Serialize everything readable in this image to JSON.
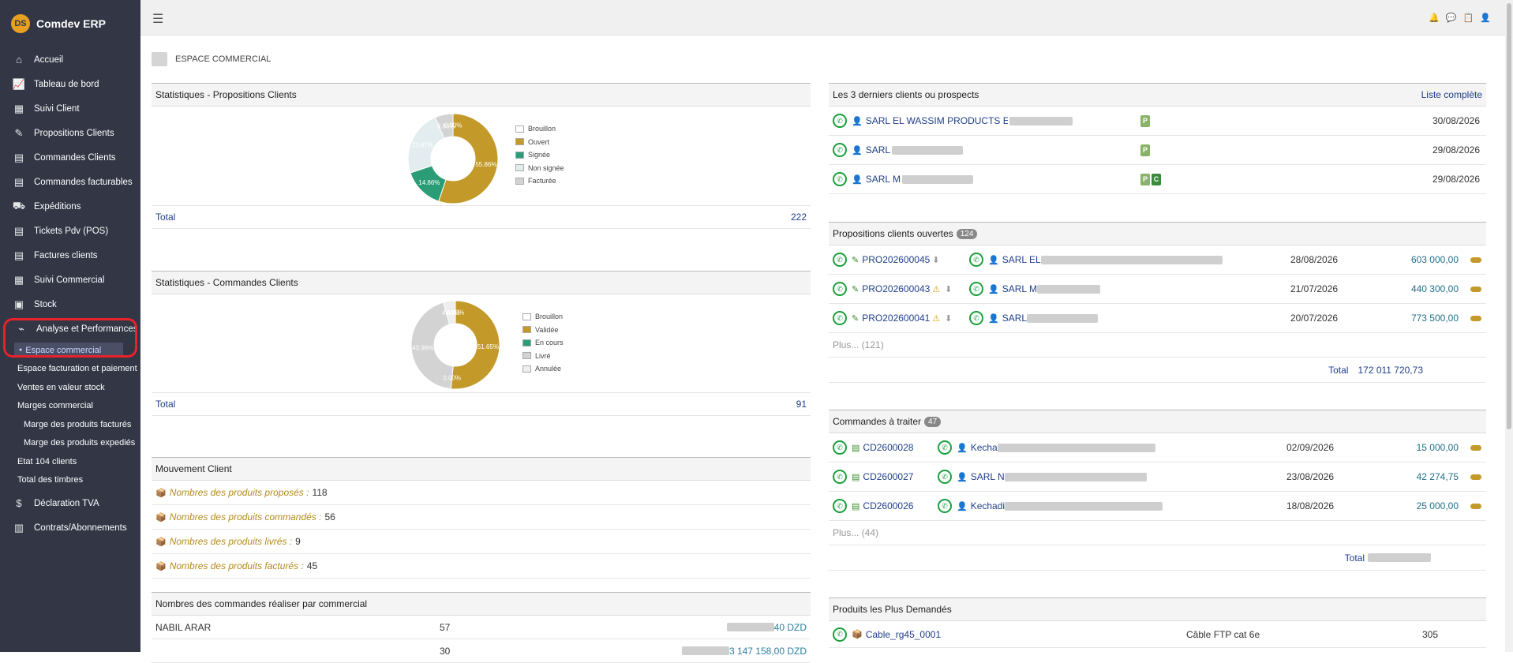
{
  "app": {
    "name": "Comdev ERP"
  },
  "sidebar": {
    "items": [
      {
        "label": "Accueil",
        "icon": "home-icon"
      },
      {
        "label": "Tableau de bord",
        "icon": "chart-line-icon"
      },
      {
        "label": "Suivi Client",
        "icon": "building-icon"
      },
      {
        "label": "Propositions Clients",
        "icon": "file-edit-icon"
      },
      {
        "label": "Commandes Clients",
        "icon": "file-icon"
      },
      {
        "label": "Commandes facturables",
        "icon": "file-icon"
      },
      {
        "label": "Expéditions",
        "icon": "dolly-icon"
      },
      {
        "label": "Tickets Pdv (POS)",
        "icon": "file-icon"
      },
      {
        "label": "Factures clients",
        "icon": "file-icon"
      },
      {
        "label": "Suivi Commercial",
        "icon": "building-icon"
      },
      {
        "label": "Stock",
        "icon": "box-icon"
      },
      {
        "label": "Analyse et Performances",
        "icon": "chart-area-icon"
      }
    ],
    "active_sub": "Espace commercial",
    "sub_items": [
      "Espace facturation et paiement",
      "Ventes en valeur stock",
      "Marges commercial"
    ],
    "sub2_items": [
      "Marge des produits facturés",
      "Marge des produits expediés"
    ],
    "sub3_items": [
      "Etat 104 clients",
      "Total des timbres"
    ],
    "bottom_items": [
      {
        "label": "Déclaration TVA",
        "icon": "tax-icon"
      },
      {
        "label": "Contrats/Abonnements",
        "icon": "briefcase-icon"
      }
    ]
  },
  "page": {
    "title": "ESPACE COMMERCIAL"
  },
  "stats_props": {
    "title": "Statistiques - Propositions Clients",
    "total_label": "Total",
    "total_value": "222",
    "legend": [
      "Brouillon",
      "Ouvert",
      "Signée",
      "Non signée",
      "Facturée"
    ],
    "slice_labels": [
      "55.86%",
      "14.86%",
      "23.87%",
      "6.60%",
      "0.00%"
    ]
  },
  "stats_cmds": {
    "title": "Statistiques - Commandes Clients",
    "total_label": "Total",
    "total_value": "91",
    "legend": [
      "Brouillon",
      "Validée",
      "En cours",
      "Livré",
      "Annulée"
    ],
    "slice_labels": [
      "51.65%",
      "0.00%",
      "43.96%",
      "4.40%",
      "0.00%"
    ]
  },
  "chart_data": [
    {
      "type": "pie",
      "title": "Statistiques - Propositions Clients",
      "categories": [
        "Brouillon",
        "Ouvert",
        "Signée",
        "Non signée",
        "Facturée"
      ],
      "values": [
        0,
        55.86,
        14.86,
        23.87,
        6.6
      ],
      "colors": [
        "#ffffff",
        "#c39a2a",
        "#2a9d77",
        "#e3edef",
        "#d3d3d3"
      ]
    },
    {
      "type": "pie",
      "title": "Statistiques - Commandes Clients",
      "categories": [
        "Brouillon",
        "Validée",
        "En cours",
        "Livré",
        "Annulée"
      ],
      "values": [
        0,
        51.65,
        0,
        43.96,
        4.4
      ],
      "colors": [
        "#ffffff",
        "#c39a2a",
        "#2a9d77",
        "#d3d3d3",
        "#eeeeee"
      ]
    }
  ],
  "mouvement": {
    "title": "Mouvement Client",
    "rows": [
      {
        "label": "Nombres des produits proposés :",
        "value": "118"
      },
      {
        "label": "Nombres des produits commandés :",
        "value": "56"
      },
      {
        "label": "Nombres des produits livrés :",
        "value": "9"
      },
      {
        "label": "Nombres des produits facturés :",
        "value": "45"
      }
    ]
  },
  "par_commercial": {
    "title": "Nombres des commandes réaliser par commercial",
    "rows": [
      {
        "name": "NABIL ARAR",
        "count": "57",
        "amount": "40 DZD"
      },
      {
        "name": "",
        "count": "30",
        "amount": "3 147 158,00 DZD"
      }
    ]
  },
  "derniers": {
    "title": "Les 3 derniers clients ou prospects",
    "link": "Liste complète",
    "rows": [
      {
        "name": "SARL EL WASSIM PRODUCTS EQAM (Hamza Zaoui)",
        "tags": [
          "P"
        ],
        "date": "30/08/2026"
      },
      {
        "name": "SARL",
        "tags": [
          "P"
        ],
        "date": "29/08/2026"
      },
      {
        "name": "SARL M",
        "tags": [
          "P",
          "C"
        ],
        "date": "29/08/2026"
      }
    ]
  },
  "propositions": {
    "title": "Propositions clients ouvertes",
    "count": "124",
    "rows": [
      {
        "ref": "PRO202600045",
        "client": "SARL EL",
        "date": "28/08/2026",
        "amount": "603 000,00",
        "warn": false
      },
      {
        "ref": "PRO202600043",
        "client": "SARL M",
        "date": "21/07/2026",
        "amount": "440 300,00",
        "warn": true
      },
      {
        "ref": "PRO202600041",
        "client": "SARL",
        "date": "20/07/2026",
        "amount": "773 500,00",
        "warn": true
      }
    ],
    "more": "Plus... (121)",
    "total_label": "Total",
    "total_value": "172 011 720,73"
  },
  "commandes": {
    "title": "Commandes à traiter",
    "count": "47",
    "rows": [
      {
        "ref": "CD2600028",
        "client": "Kecha",
        "date": "02/09/2026",
        "amount": "15 000,00"
      },
      {
        "ref": "CD2600027",
        "client": "SARL N",
        "date": "23/08/2026",
        "amount": "42 274,75"
      },
      {
        "ref": "CD2600026",
        "client": "Kechadi",
        "date": "18/08/2026",
        "amount": "25 000,00"
      }
    ],
    "more": "Plus... (44)",
    "total_label": "Total"
  },
  "produits": {
    "title": "Produits les Plus Demandés",
    "rows": [
      {
        "ref": "Cable_rg45_0001",
        "label": "Câble FTP cat 6e",
        "qty": "305"
      }
    ]
  }
}
